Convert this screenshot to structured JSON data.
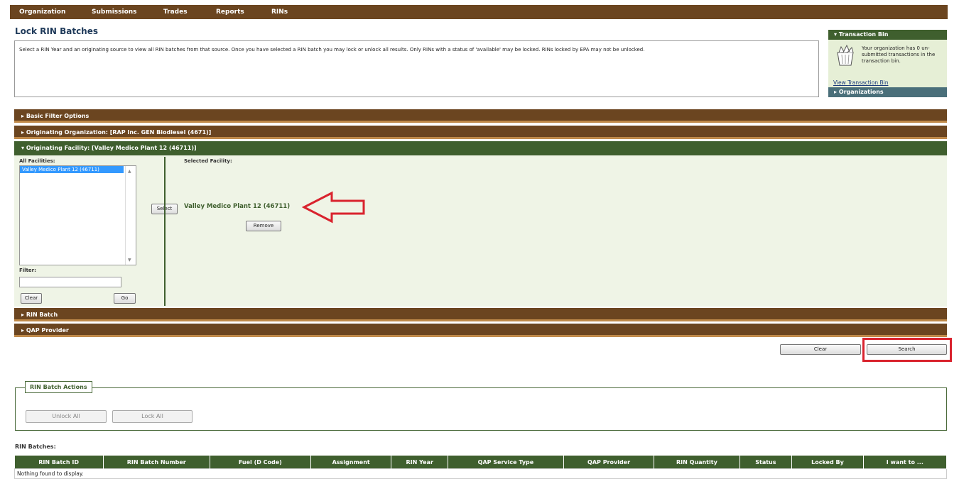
{
  "nav": {
    "items": [
      "Organization",
      "Submissions",
      "Trades",
      "Reports",
      "RINs"
    ]
  },
  "page": {
    "title": "Lock RIN Batches",
    "description": "Select a RIN Year and an originating source to view all RIN batches from that source. Once you have selected a RIN batch you may lock or unlock all results. Only RINs with a status of 'available' may be locked. RINs locked by EPA may not be unlocked."
  },
  "sections": {
    "basic_filter": "Basic Filter Options",
    "originating_org": "Originating Organization: [RAP Inc. GEN Biodiesel (4671)]",
    "originating_facility": "Originating Facility: [Valley Medico Plant 12 (46711)]",
    "rin_batch": "RIN Batch",
    "qap_provider": "QAP Provider"
  },
  "facility": {
    "all_label": "All Facilities:",
    "options": [
      "Valley Medico Plant 12 (46711)"
    ],
    "filter_label": "Filter:",
    "filter_value": "",
    "clear_label": "Clear",
    "go_label": "Go",
    "select_label": "Select",
    "selected_label": "Selected Facility:",
    "selected_value": "Valley Medico Plant 12 (46711)",
    "remove_label": "Remove"
  },
  "search_controls": {
    "clear_label": "Clear",
    "search_label": "Search"
  },
  "actions": {
    "legend": "RIN Batch Actions",
    "unlock_label": "Unlock All",
    "lock_label": "Lock All"
  },
  "results": {
    "label": "RIN Batches:",
    "columns": [
      "RIN Batch ID",
      "RIN Batch Number",
      "Fuel (D Code)",
      "Assignment",
      "RIN Year",
      "QAP Service Type",
      "QAP Provider",
      "RIN Quantity",
      "Status",
      "Locked By",
      "I want to ..."
    ],
    "empty_message": "Nothing found to display."
  },
  "sidebar": {
    "transaction_bin_title": "Transaction Bin",
    "transaction_bin_text": "Your organization has 0 un-submitted transactions in the transaction bin.",
    "view_link": "View Transaction Bin",
    "organizations_title": "Organizations"
  },
  "colors": {
    "nav_brown": "#6b4520",
    "section_green": "#3f5f2e",
    "highlight_red": "#d9232e",
    "panel_bg": "#eff4e6"
  }
}
